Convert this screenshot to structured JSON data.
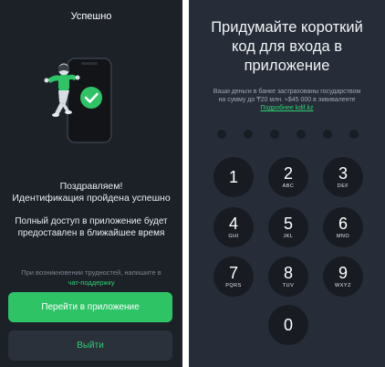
{
  "left": {
    "title": "Успешно",
    "congrats_line1": "Поздравляем!",
    "congrats_line2": "Идентификация пройдена успешно",
    "access_line1": "Полный доступ в приложение будет",
    "access_line2": "предоставлен в ближайшее время",
    "help_text": "При возникновении трудностей, напишите в",
    "help_link": "чат-поддержку",
    "primary_button": "Перейти в приложение",
    "secondary_button": "Выйти"
  },
  "right": {
    "title_line1": "Придумайте короткий",
    "title_line2": "код для входа в",
    "title_line3": "приложение",
    "insured_line1": "Ваши деньги в банке застрахованы государством",
    "insured_line2": "на сумму до ₸20 млн. ≈$45 000 в эквиваленте",
    "insured_link": "Подробнее kdif.kz",
    "pin_length": 6,
    "keys": [
      {
        "num": "1",
        "letters": ""
      },
      {
        "num": "2",
        "letters": "ABC"
      },
      {
        "num": "3",
        "letters": "DEF"
      },
      {
        "num": "4",
        "letters": "GHI"
      },
      {
        "num": "5",
        "letters": "JKL"
      },
      {
        "num": "6",
        "letters": "MNO"
      },
      {
        "num": "7",
        "letters": "PQRS"
      },
      {
        "num": "8",
        "letters": "TUV"
      },
      {
        "num": "9",
        "letters": "WXYZ"
      },
      {
        "num": "0",
        "letters": ""
      }
    ]
  },
  "colors": {
    "accent": "#2ec466",
    "left_bg": "#1c2128",
    "right_bg": "#262d38",
    "key_bg": "#181c22"
  }
}
